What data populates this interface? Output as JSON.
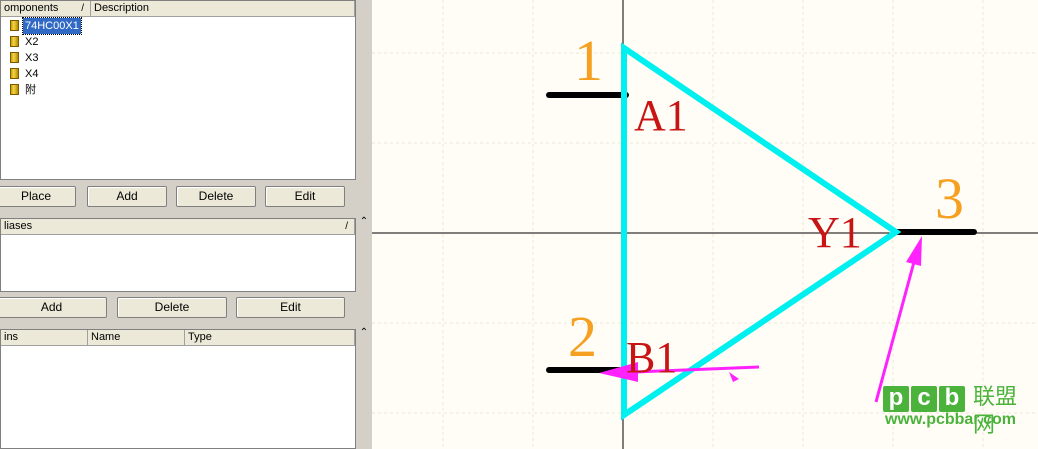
{
  "components_panel": {
    "col_components": "omponents",
    "sort_mark": "/",
    "col_description": "Description",
    "items": [
      "74HC00X1",
      "X2",
      "X3",
      "X4",
      "附"
    ],
    "selected_index": 0,
    "buttons": {
      "place": "Place",
      "add": "Add",
      "delete": "Delete",
      "edit": "Edit"
    }
  },
  "aliases_panel": {
    "header": "liases",
    "sort_mark": "/",
    "buttons": {
      "add": "Add",
      "delete": "Delete",
      "edit": "Edit"
    }
  },
  "pins_panel": {
    "col_pins": "ins",
    "col_name": "Name",
    "col_type": "Type"
  },
  "scroll_arrow": "⌃",
  "schematic": {
    "pins": [
      {
        "number": "1",
        "name": "A1"
      },
      {
        "number": "2",
        "name": "B1"
      },
      {
        "number": "3",
        "name": "Y1"
      }
    ],
    "colors": {
      "body": "#00f0f0",
      "pin_line": "#000000",
      "pin_number": "#f5a020",
      "pin_name": "#c81414",
      "annotation_arrow": "#ff22ff",
      "grid": "#ebe6da",
      "axis": "#000000"
    }
  },
  "watermark": {
    "letters": [
      "p",
      "c",
      "b"
    ],
    "cn_text": "联盟网",
    "url": "www.pcbbar.com",
    "color": "#4bb33c"
  }
}
